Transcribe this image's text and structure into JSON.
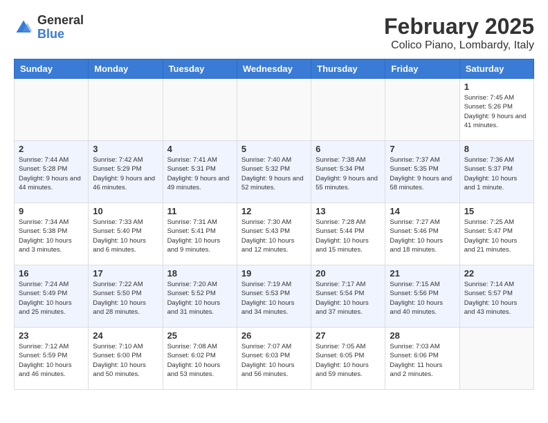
{
  "logo": {
    "general": "General",
    "blue": "Blue"
  },
  "title": {
    "month_year": "February 2025",
    "location": "Colico Piano, Lombardy, Italy"
  },
  "days_of_week": [
    "Sunday",
    "Monday",
    "Tuesday",
    "Wednesday",
    "Thursday",
    "Friday",
    "Saturday"
  ],
  "weeks": [
    [
      {
        "day": "",
        "info": ""
      },
      {
        "day": "",
        "info": ""
      },
      {
        "day": "",
        "info": ""
      },
      {
        "day": "",
        "info": ""
      },
      {
        "day": "",
        "info": ""
      },
      {
        "day": "",
        "info": ""
      },
      {
        "day": "1",
        "info": "Sunrise: 7:45 AM\nSunset: 5:26 PM\nDaylight: 9 hours and 41 minutes."
      }
    ],
    [
      {
        "day": "2",
        "info": "Sunrise: 7:44 AM\nSunset: 5:28 PM\nDaylight: 9 hours and 44 minutes."
      },
      {
        "day": "3",
        "info": "Sunrise: 7:42 AM\nSunset: 5:29 PM\nDaylight: 9 hours and 46 minutes."
      },
      {
        "day": "4",
        "info": "Sunrise: 7:41 AM\nSunset: 5:31 PM\nDaylight: 9 hours and 49 minutes."
      },
      {
        "day": "5",
        "info": "Sunrise: 7:40 AM\nSunset: 5:32 PM\nDaylight: 9 hours and 52 minutes."
      },
      {
        "day": "6",
        "info": "Sunrise: 7:38 AM\nSunset: 5:34 PM\nDaylight: 9 hours and 55 minutes."
      },
      {
        "day": "7",
        "info": "Sunrise: 7:37 AM\nSunset: 5:35 PM\nDaylight: 9 hours and 58 minutes."
      },
      {
        "day": "8",
        "info": "Sunrise: 7:36 AM\nSunset: 5:37 PM\nDaylight: 10 hours and 1 minute."
      }
    ],
    [
      {
        "day": "9",
        "info": "Sunrise: 7:34 AM\nSunset: 5:38 PM\nDaylight: 10 hours and 3 minutes."
      },
      {
        "day": "10",
        "info": "Sunrise: 7:33 AM\nSunset: 5:40 PM\nDaylight: 10 hours and 6 minutes."
      },
      {
        "day": "11",
        "info": "Sunrise: 7:31 AM\nSunset: 5:41 PM\nDaylight: 10 hours and 9 minutes."
      },
      {
        "day": "12",
        "info": "Sunrise: 7:30 AM\nSunset: 5:43 PM\nDaylight: 10 hours and 12 minutes."
      },
      {
        "day": "13",
        "info": "Sunrise: 7:28 AM\nSunset: 5:44 PM\nDaylight: 10 hours and 15 minutes."
      },
      {
        "day": "14",
        "info": "Sunrise: 7:27 AM\nSunset: 5:46 PM\nDaylight: 10 hours and 18 minutes."
      },
      {
        "day": "15",
        "info": "Sunrise: 7:25 AM\nSunset: 5:47 PM\nDaylight: 10 hours and 21 minutes."
      }
    ],
    [
      {
        "day": "16",
        "info": "Sunrise: 7:24 AM\nSunset: 5:49 PM\nDaylight: 10 hours and 25 minutes."
      },
      {
        "day": "17",
        "info": "Sunrise: 7:22 AM\nSunset: 5:50 PM\nDaylight: 10 hours and 28 minutes."
      },
      {
        "day": "18",
        "info": "Sunrise: 7:20 AM\nSunset: 5:52 PM\nDaylight: 10 hours and 31 minutes."
      },
      {
        "day": "19",
        "info": "Sunrise: 7:19 AM\nSunset: 5:53 PM\nDaylight: 10 hours and 34 minutes."
      },
      {
        "day": "20",
        "info": "Sunrise: 7:17 AM\nSunset: 5:54 PM\nDaylight: 10 hours and 37 minutes."
      },
      {
        "day": "21",
        "info": "Sunrise: 7:15 AM\nSunset: 5:56 PM\nDaylight: 10 hours and 40 minutes."
      },
      {
        "day": "22",
        "info": "Sunrise: 7:14 AM\nSunset: 5:57 PM\nDaylight: 10 hours and 43 minutes."
      }
    ],
    [
      {
        "day": "23",
        "info": "Sunrise: 7:12 AM\nSunset: 5:59 PM\nDaylight: 10 hours and 46 minutes."
      },
      {
        "day": "24",
        "info": "Sunrise: 7:10 AM\nSunset: 6:00 PM\nDaylight: 10 hours and 50 minutes."
      },
      {
        "day": "25",
        "info": "Sunrise: 7:08 AM\nSunset: 6:02 PM\nDaylight: 10 hours and 53 minutes."
      },
      {
        "day": "26",
        "info": "Sunrise: 7:07 AM\nSunset: 6:03 PM\nDaylight: 10 hours and 56 minutes."
      },
      {
        "day": "27",
        "info": "Sunrise: 7:05 AM\nSunset: 6:05 PM\nDaylight: 10 hours and 59 minutes."
      },
      {
        "day": "28",
        "info": "Sunrise: 7:03 AM\nSunset: 6:06 PM\nDaylight: 11 hours and 2 minutes."
      },
      {
        "day": "",
        "info": ""
      }
    ]
  ]
}
